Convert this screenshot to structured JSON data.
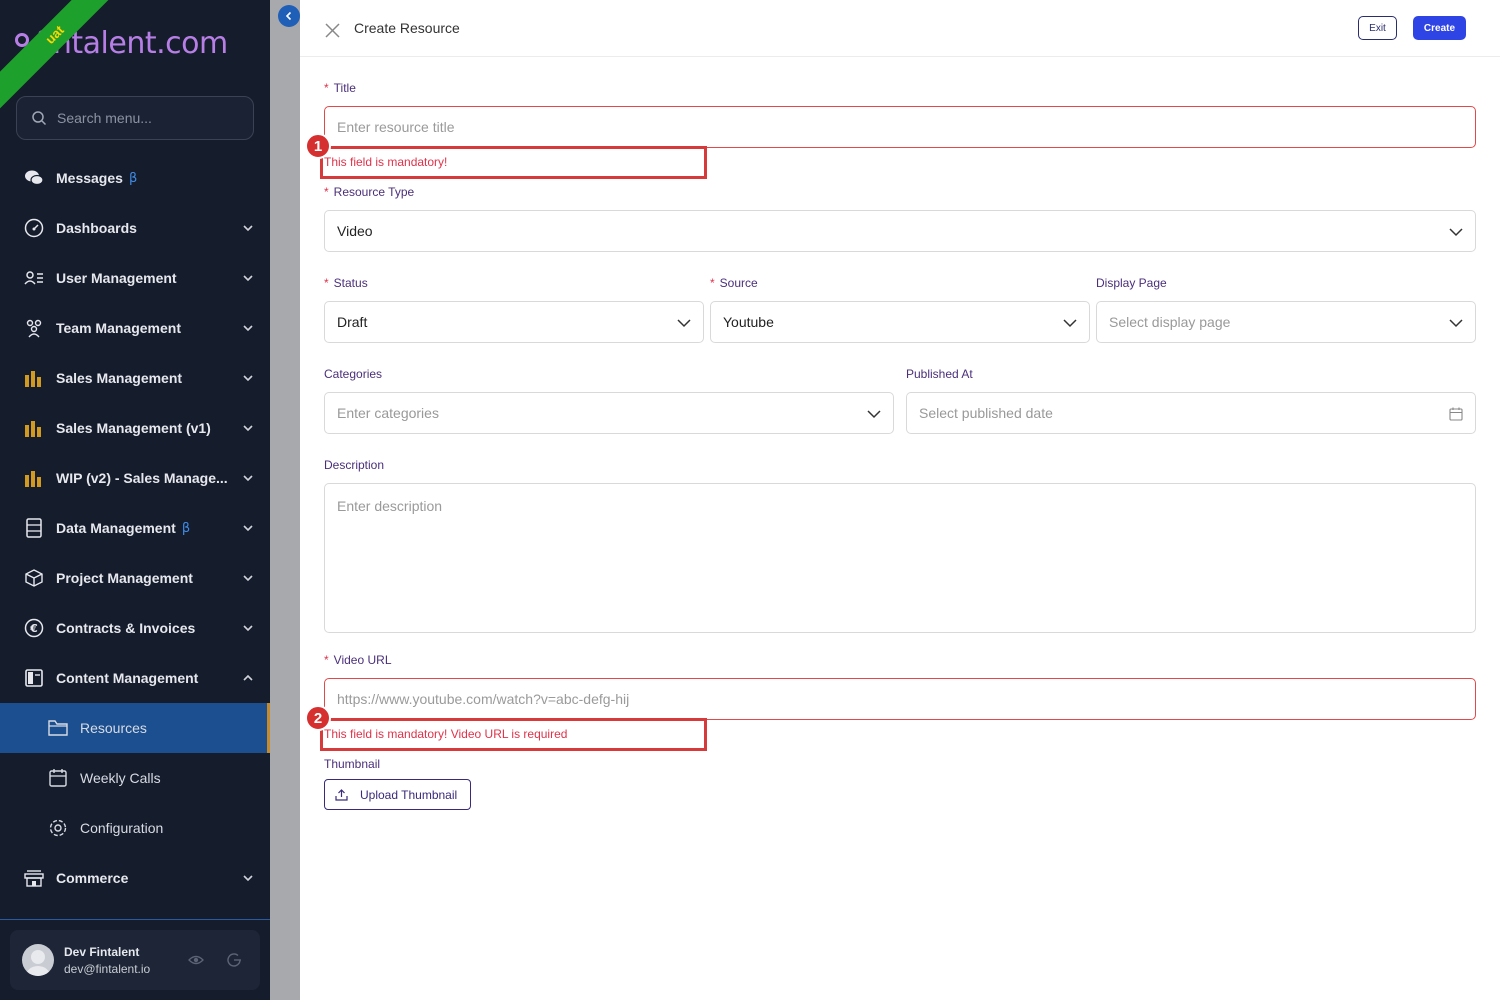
{
  "brand": {
    "logo_text": "fintalent.com",
    "env_badge": "uat"
  },
  "sidebar": {
    "search_placeholder": "Search menu...",
    "beta_symbol": "β",
    "items": [
      {
        "label": "Messages",
        "icon": "chat-icon",
        "beta": true,
        "chevron": false
      },
      {
        "label": "Dashboards",
        "icon": "gauge-icon",
        "beta": false,
        "chevron": true
      },
      {
        "label": "User Management",
        "icon": "user-list-icon",
        "beta": false,
        "chevron": true
      },
      {
        "label": "Team Management",
        "icon": "team-icon",
        "beta": false,
        "chevron": true
      },
      {
        "label": "Sales Management",
        "icon": "bar-chart-icon",
        "beta": false,
        "chevron": true
      },
      {
        "label": "Sales Management (v1)",
        "icon": "bar-chart-icon",
        "beta": false,
        "chevron": true
      },
      {
        "label": "WIP (v2) - Sales Manage...",
        "icon": "bar-chart-icon",
        "beta": false,
        "chevron": true
      },
      {
        "label": "Data Management",
        "icon": "database-icon",
        "beta": true,
        "chevron": true
      },
      {
        "label": "Project Management",
        "icon": "cube-icon",
        "beta": false,
        "chevron": true
      },
      {
        "label": "Contracts & Invoices",
        "icon": "euro-icon",
        "beta": false,
        "chevron": true
      },
      {
        "label": "Content Management",
        "icon": "layout-icon",
        "beta": false,
        "chevron": true,
        "expanded": true
      }
    ],
    "sub_items": [
      {
        "label": "Resources",
        "icon": "folder-icon",
        "active": true
      },
      {
        "label": "Weekly Calls",
        "icon": "calendar-icon",
        "active": false
      },
      {
        "label": "Configuration",
        "icon": "gear-icon",
        "active": false
      }
    ],
    "after_items": [
      {
        "label": "Commerce",
        "icon": "store-icon",
        "chevron": true
      }
    ],
    "user": {
      "name": "Dev Fintalent",
      "email": "dev@fintalent.io"
    }
  },
  "header": {
    "title": "Create Resource",
    "exit_label": "Exit",
    "create_label": "Create"
  },
  "form": {
    "title": {
      "label": "Title",
      "placeholder": "Enter resource title",
      "error": "This field is mandatory!"
    },
    "resource_type": {
      "label": "Resource Type",
      "value": "Video"
    },
    "status": {
      "label": "Status",
      "value": "Draft"
    },
    "source": {
      "label": "Source",
      "value": "Youtube"
    },
    "display_page": {
      "label": "Display Page",
      "placeholder": "Select display page"
    },
    "categories": {
      "label": "Categories",
      "placeholder": "Enter categories"
    },
    "published_at": {
      "label": "Published At",
      "placeholder": "Select published date"
    },
    "description": {
      "label": "Description",
      "placeholder": "Enter description"
    },
    "video_url": {
      "label": "Video URL",
      "placeholder": "https://www.youtube.com/watch?v=abc-defg-hij",
      "error": "This field is mandatory! Video URL is required"
    },
    "thumbnail": {
      "label": "Thumbnail",
      "button_label": "Upload Thumbnail"
    },
    "required_mark": "*"
  },
  "annotations": {
    "marker_1": "1",
    "marker_2": "2"
  },
  "colors": {
    "sidebar_bg": "#151c2c",
    "active_item": "#1b4f8f",
    "primary": "#2f44e4",
    "error": "#e0334a",
    "label": "#4a2f7a"
  }
}
